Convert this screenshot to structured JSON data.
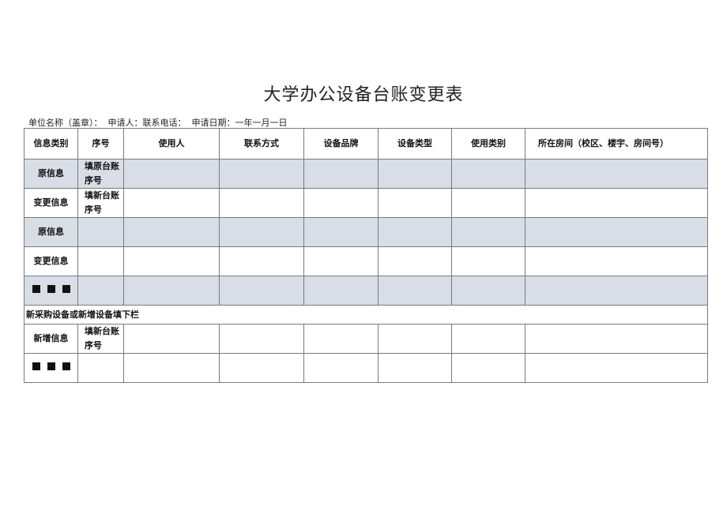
{
  "title": "大学办公设备台账变更表",
  "meta_line": "单位名称（盖章）：  申请人：联系电话：  申请日期：一年一月一日",
  "table": {
    "headers": [
      "信息类别",
      "序号",
      "使用人",
      "联系方式",
      "设备品牌",
      "设备类型",
      "使用类别",
      "所在房间（校区、楼宇、房间号）"
    ],
    "rows": [
      {
        "category": "原信息",
        "seq": "填原台账序号",
        "shaded": true
      },
      {
        "category": "变更信息",
        "seq": "填新台账序号",
        "shaded": false
      },
      {
        "category": "原信息",
        "seq": "",
        "shaded": true
      },
      {
        "category": "变更信息",
        "seq": "",
        "shaded": false
      },
      {
        "category": "■■■",
        "seq": "",
        "shaded": true
      }
    ],
    "section_label": "新采购设备或新增设备填下栏",
    "new_rows": [
      {
        "category": "新增信息",
        "seq": "填新台账序号"
      },
      {
        "category": "■■■",
        "seq": ""
      }
    ]
  },
  "colors": {
    "shade": "#d9dde6",
    "border": "#7a7a7a"
  }
}
